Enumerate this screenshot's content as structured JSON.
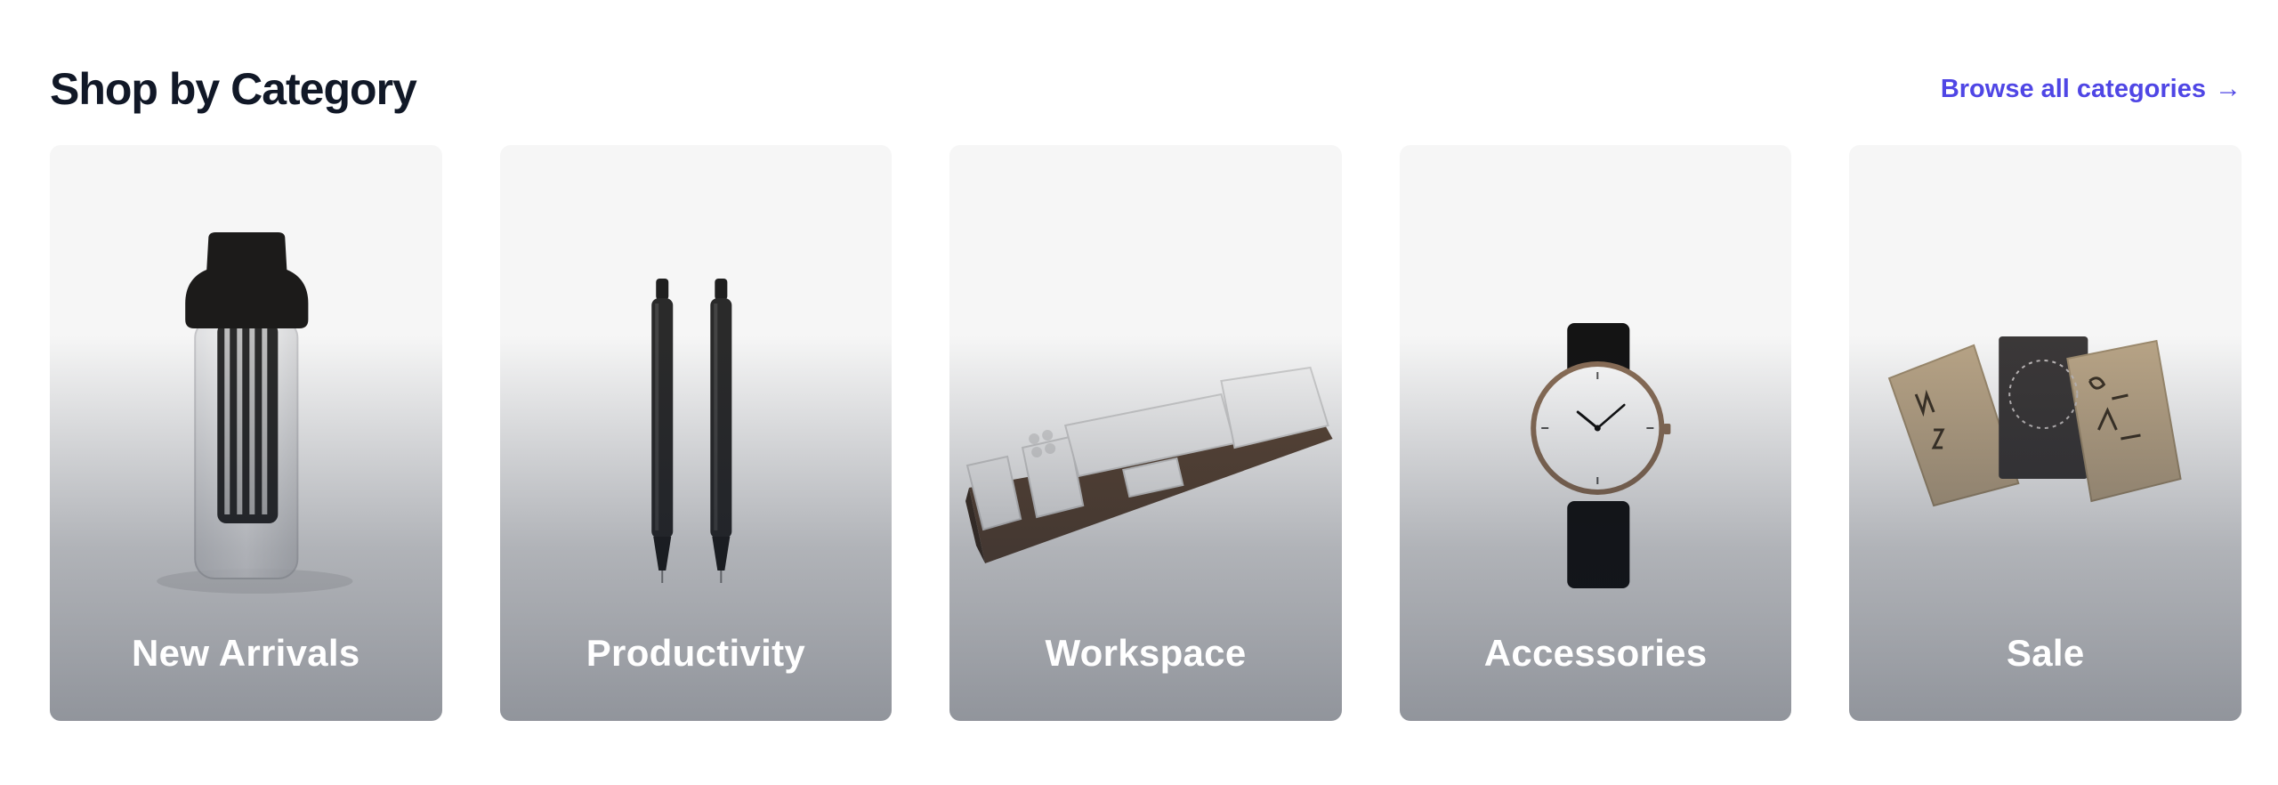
{
  "section": {
    "title": "Shop by Category",
    "browse_link_label": "Browse all categories",
    "browse_link_arrow": "→"
  },
  "categories": [
    {
      "label": "New Arrivals",
      "image": "cold-brew-carafe"
    },
    {
      "label": "Productivity",
      "image": "two-black-pens"
    },
    {
      "label": "Workspace",
      "image": "desk-organizer-tray"
    },
    {
      "label": "Accessories",
      "image": "wristwatch"
    },
    {
      "label": "Sale",
      "image": "three-notebooks"
    }
  ],
  "colors": {
    "heading": "#111827",
    "link": "#4f46e5",
    "card_background": "#f6f6f6",
    "card_label": "#ffffff"
  }
}
